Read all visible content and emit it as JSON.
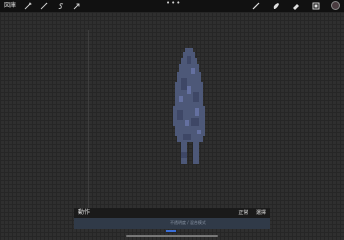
{
  "top_bar": {
    "gallery_label": "図庫",
    "left_tools": [
      "wrench-icon",
      "magic-wand-icon",
      "adjust-s-icon",
      "move-arrow-icon"
    ],
    "more_glyph": "•••",
    "right_tools": [
      "brush-icon",
      "smudge-icon",
      "eraser-icon",
      "layers-icon"
    ],
    "current_color": "#4a3c40"
  },
  "layer_panel": {
    "title": "動作",
    "mode_label": "正常",
    "option_label": "選擇",
    "strip_hint": "不透明度 / 混合模式"
  },
  "colors": {
    "sprite_fill": "#4d5878",
    "sprite_dark": "#3e4766",
    "sprite_light": "#6470a0",
    "accent": "#3b6fd9"
  }
}
